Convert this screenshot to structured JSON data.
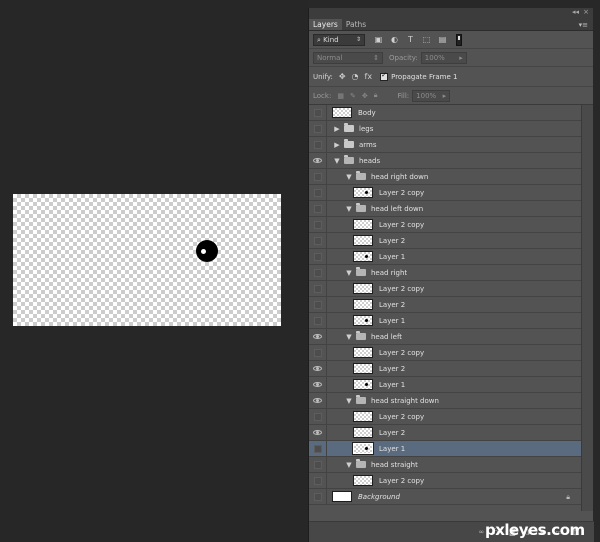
{
  "watermark": "pxleyes.com",
  "panel": {
    "tabs": [
      {
        "label": "Layers",
        "active": true
      },
      {
        "label": "Paths",
        "active": false
      }
    ],
    "filter_kind": "Kind",
    "blend_mode": "Normal",
    "opacity_label": "Opacity:",
    "opacity_value": "100%",
    "unify_label": "Unify:",
    "propagate_label": "Propagate Frame 1",
    "lock_label": "Lock:",
    "fill_label": "Fill:",
    "fill_value": "100%"
  },
  "layers": [
    {
      "name": "Body",
      "visible": false,
      "indent": 0,
      "type": "layer",
      "thumb": "checker"
    },
    {
      "name": "legs",
      "visible": false,
      "indent": 0,
      "type": "group",
      "expanded": false
    },
    {
      "name": "arms",
      "visible": false,
      "indent": 0,
      "type": "group",
      "expanded": false
    },
    {
      "name": "heads",
      "visible": true,
      "indent": 0,
      "type": "group",
      "expanded": true
    },
    {
      "name": "head right down",
      "visible": false,
      "indent": 1,
      "type": "group",
      "expanded": true
    },
    {
      "name": "Layer 2 copy",
      "visible": false,
      "indent": 2,
      "type": "layer",
      "thumb": "dot"
    },
    {
      "name": "head left down",
      "visible": false,
      "indent": 1,
      "type": "group",
      "expanded": true
    },
    {
      "name": "Layer 2 copy",
      "visible": false,
      "indent": 2,
      "type": "layer",
      "thumb": "checker"
    },
    {
      "name": "Layer 2",
      "visible": false,
      "indent": 2,
      "type": "layer",
      "thumb": "checker"
    },
    {
      "name": "Layer 1",
      "visible": false,
      "indent": 2,
      "type": "layer",
      "thumb": "dot"
    },
    {
      "name": "head right",
      "visible": false,
      "indent": 1,
      "type": "group",
      "expanded": true
    },
    {
      "name": "Layer 2 copy",
      "visible": false,
      "indent": 2,
      "type": "layer",
      "thumb": "checker"
    },
    {
      "name": "Layer 2",
      "visible": false,
      "indent": 2,
      "type": "layer",
      "thumb": "checker"
    },
    {
      "name": "Layer 1",
      "visible": false,
      "indent": 2,
      "type": "layer",
      "thumb": "dot"
    },
    {
      "name": "head left",
      "visible": true,
      "indent": 1,
      "type": "group",
      "expanded": true
    },
    {
      "name": "Layer 2 copy",
      "visible": false,
      "indent": 2,
      "type": "layer",
      "thumb": "checker"
    },
    {
      "name": "Layer 2",
      "visible": true,
      "indent": 2,
      "type": "layer",
      "thumb": "checker"
    },
    {
      "name": "Layer 1",
      "visible": true,
      "indent": 2,
      "type": "layer",
      "thumb": "dot"
    },
    {
      "name": "head straight down",
      "visible": true,
      "indent": 1,
      "type": "group",
      "expanded": true
    },
    {
      "name": "Layer 2 copy",
      "visible": false,
      "indent": 2,
      "type": "layer",
      "thumb": "checker"
    },
    {
      "name": "Layer 2",
      "visible": true,
      "indent": 2,
      "type": "layer",
      "thumb": "checker"
    },
    {
      "name": "Layer 1",
      "visible": false,
      "indent": 2,
      "type": "layer",
      "thumb": "dot",
      "selected": true
    },
    {
      "name": "head straight",
      "visible": false,
      "indent": 1,
      "type": "group",
      "expanded": true
    },
    {
      "name": "Layer 2 copy",
      "visible": false,
      "indent": 2,
      "type": "layer",
      "thumb": "checker"
    },
    {
      "name": "Background",
      "visible": false,
      "indent": 0,
      "type": "background",
      "thumb": "white",
      "locked": true
    }
  ],
  "colors": {
    "panel_bg": "#535353",
    "selected_row": "#5a6a7f",
    "workspace": "#282828"
  }
}
